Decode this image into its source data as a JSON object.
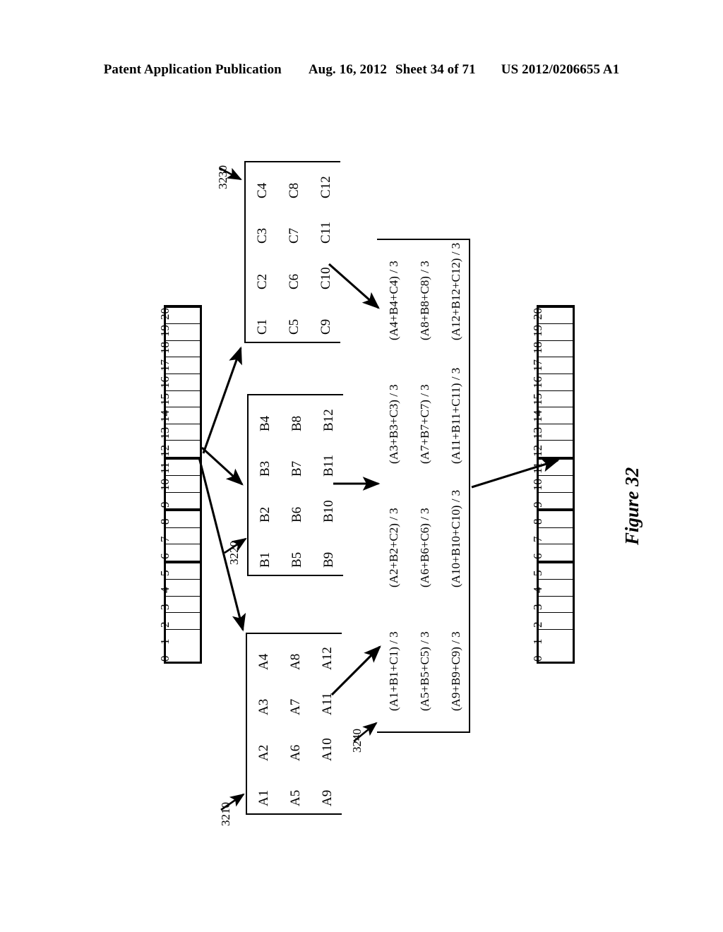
{
  "header": {
    "publication": "Patent Application Publication",
    "date": "Aug. 16, 2012",
    "sheet": "Sheet 34 of 71",
    "docnum": "US 2012/0206655 A1"
  },
  "figure": {
    "caption": "Figure 32",
    "refs": {
      "matrix_a": "3210",
      "matrix_b": "3220",
      "matrix_c": "3230",
      "result": "3240"
    }
  },
  "input_array": {
    "name": "input-array",
    "indices": [
      "0",
      "1",
      "2",
      "3",
      "4",
      "5",
      "6",
      "7",
      "8",
      "9",
      "10",
      "11",
      "12",
      "13",
      "14",
      "15",
      "16",
      "17",
      "18",
      "19",
      "20"
    ],
    "cell_count": 21,
    "thick_dividers_after": [
      5,
      8,
      11
    ]
  },
  "output_array": {
    "name": "output-array",
    "indices": [
      "0",
      "1",
      "2",
      "3",
      "4",
      "5",
      "6",
      "7",
      "8",
      "9",
      "10",
      "11",
      "12",
      "13",
      "14",
      "15",
      "16",
      "17",
      "18",
      "19",
      "20"
    ],
    "cell_count": 21,
    "thick_dividers_after": [
      5,
      8,
      11
    ]
  },
  "matrix_a": {
    "label": "3210",
    "rows": [
      [
        "A1",
        "A2",
        "A3",
        "A4"
      ],
      [
        "A5",
        "A6",
        "A7",
        "A8"
      ],
      [
        "A9",
        "A10",
        "A11",
        "A12"
      ]
    ]
  },
  "matrix_b": {
    "label": "3220",
    "rows": [
      [
        "B1",
        "B2",
        "B3",
        "B4"
      ],
      [
        "B5",
        "B6",
        "B7",
        "B8"
      ],
      [
        "B9",
        "B10",
        "B11",
        "B12"
      ]
    ]
  },
  "matrix_c": {
    "label": "3230",
    "rows": [
      [
        "C1",
        "C2",
        "C3",
        "C4"
      ],
      [
        "C5",
        "C6",
        "C7",
        "C8"
      ],
      [
        "C9",
        "C10",
        "C11",
        "C12"
      ]
    ]
  },
  "result_matrix": {
    "label": "3240",
    "rows": [
      [
        "(A1+B1+C1) / 3",
        "(A2+B2+C2) / 3",
        "(A3+B3+C3) / 3",
        "(A4+B4+C4) / 3"
      ],
      [
        "(A5+B5+C5) / 3",
        "(A6+B6+C6) / 3",
        "(A7+B7+C7) / 3",
        "(A8+B8+C8) / 3"
      ],
      [
        "(A9+B9+C9) / 3",
        "(A10+B10+C10) / 3",
        "(A11+B11+C11) / 3",
        "(A12+B12+C12) / 3"
      ]
    ]
  },
  "colors": {
    "ink": "#000000",
    "paper": "#ffffff"
  }
}
